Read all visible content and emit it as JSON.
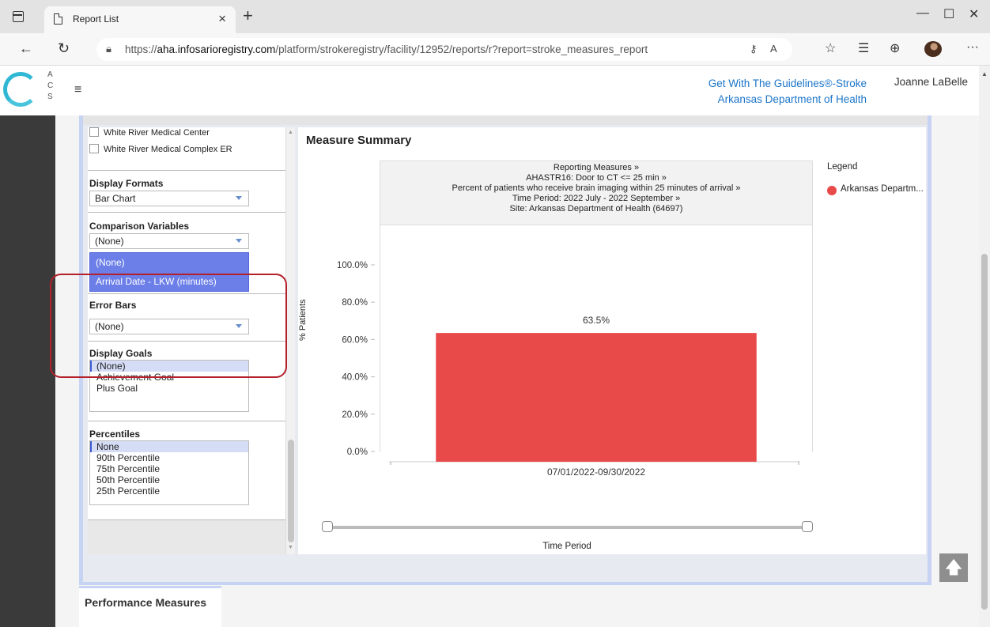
{
  "browser": {
    "tab_title": "Report List",
    "url_prefix": "https://",
    "url_domain": "aha.infosarioregistry.com",
    "url_path": "/platform/strokeregistry/facility/12952/reports/r?report=stroke_measures_report"
  },
  "header": {
    "logo_text_lines": [
      "A",
      "C",
      "S"
    ],
    "program": "Get With The Guidelines®-Stroke",
    "organization": "Arkansas Department of Health",
    "user": "Joanne LaBelle"
  },
  "filters": {
    "facilities": [
      "White River Medical Center",
      "White River Medical Complex ER"
    ],
    "display_formats": {
      "label": "Display Formats",
      "value": "Bar Chart"
    },
    "comparison_variables": {
      "label": "Comparison Variables",
      "value": "(None)",
      "options": [
        "(None)",
        "Arrival Date - LKW (minutes)"
      ]
    },
    "error_bars": {
      "label": "Error Bars",
      "value": "(None)"
    },
    "display_goals": {
      "label": "Display Goals",
      "options": [
        "(None)",
        "Achievement Goal",
        "Plus Goal"
      ],
      "selected": "(None)"
    },
    "percentiles": {
      "label": "Percentiles",
      "options": [
        "None",
        "90th Percentile",
        "75th Percentile",
        "50th Percentile",
        "25th Percentile"
      ],
      "selected": "None"
    }
  },
  "chart": {
    "section_title": "Measure Summary",
    "header_lines": [
      "Reporting Measures »",
      "AHASTR16: Door to CT <= 25 min »",
      "Percent of patients who receive brain imaging within 25 minutes of arrival »",
      "Time Period: 2022 July - 2022 September »",
      "Site: Arkansas Department of Health (64697)"
    ],
    "legend_title": "Legend",
    "slider_label": "Time Period"
  },
  "chart_data": {
    "type": "bar",
    "categories": [
      "07/01/2022-09/30/2022"
    ],
    "series": [
      {
        "name": "Arkansas Departm...",
        "values": [
          63.5
        ],
        "color": "#e84a4a"
      }
    ],
    "data_labels": [
      "63.5%"
    ],
    "ylabel": "% Patients",
    "ylim": [
      0,
      100
    ],
    "yticks": [
      "0.0%",
      "20.0%",
      "40.0%",
      "60.0%",
      "80.0%",
      "100.0%"
    ],
    "ytick_values": [
      0,
      20,
      40,
      60,
      80,
      100
    ],
    "grid": false
  },
  "footer": {
    "tab_label": "Performance Measures"
  }
}
